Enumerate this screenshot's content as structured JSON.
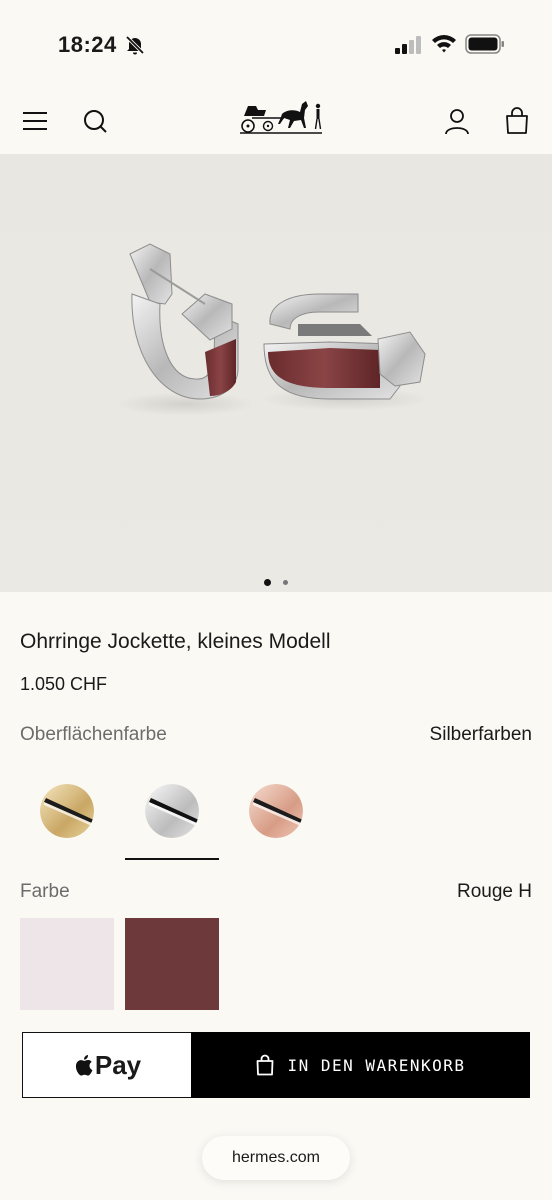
{
  "status": {
    "time": "18:24",
    "icons": [
      "bell-slash-icon",
      "signal-icon",
      "wifi-icon",
      "battery-icon"
    ]
  },
  "nav": {
    "icons": [
      "menu-icon",
      "search-icon",
      "hermes-carriage-logo",
      "account-icon",
      "shopping-bag-icon"
    ]
  },
  "gallery": {
    "slide_count": 2,
    "active_index": 0
  },
  "product": {
    "title": "Ohrringe Jockette, kleines Modell",
    "price": "1.050 CHF"
  },
  "finish": {
    "label": "Oberflächenfarbe",
    "selected_value": "Silberfarben",
    "options": [
      {
        "name": "gold",
        "color": "#d9c08a"
      },
      {
        "name": "silver",
        "color": "#d6d6d6",
        "selected": true
      },
      {
        "name": "rose-gold",
        "color": "#e5b8a4"
      }
    ]
  },
  "color": {
    "label": "Farbe",
    "selected_value": "Rouge H",
    "options": [
      {
        "name": "light-pink",
        "color": "#ede5e8"
      },
      {
        "name": "rouge-h",
        "color": "#6e393b",
        "selected": true
      }
    ]
  },
  "actions": {
    "apple_pay_label": "Pay",
    "add_to_cart_label": "IN DEN WARENKORB"
  },
  "browser": {
    "url": "hermes.com"
  }
}
